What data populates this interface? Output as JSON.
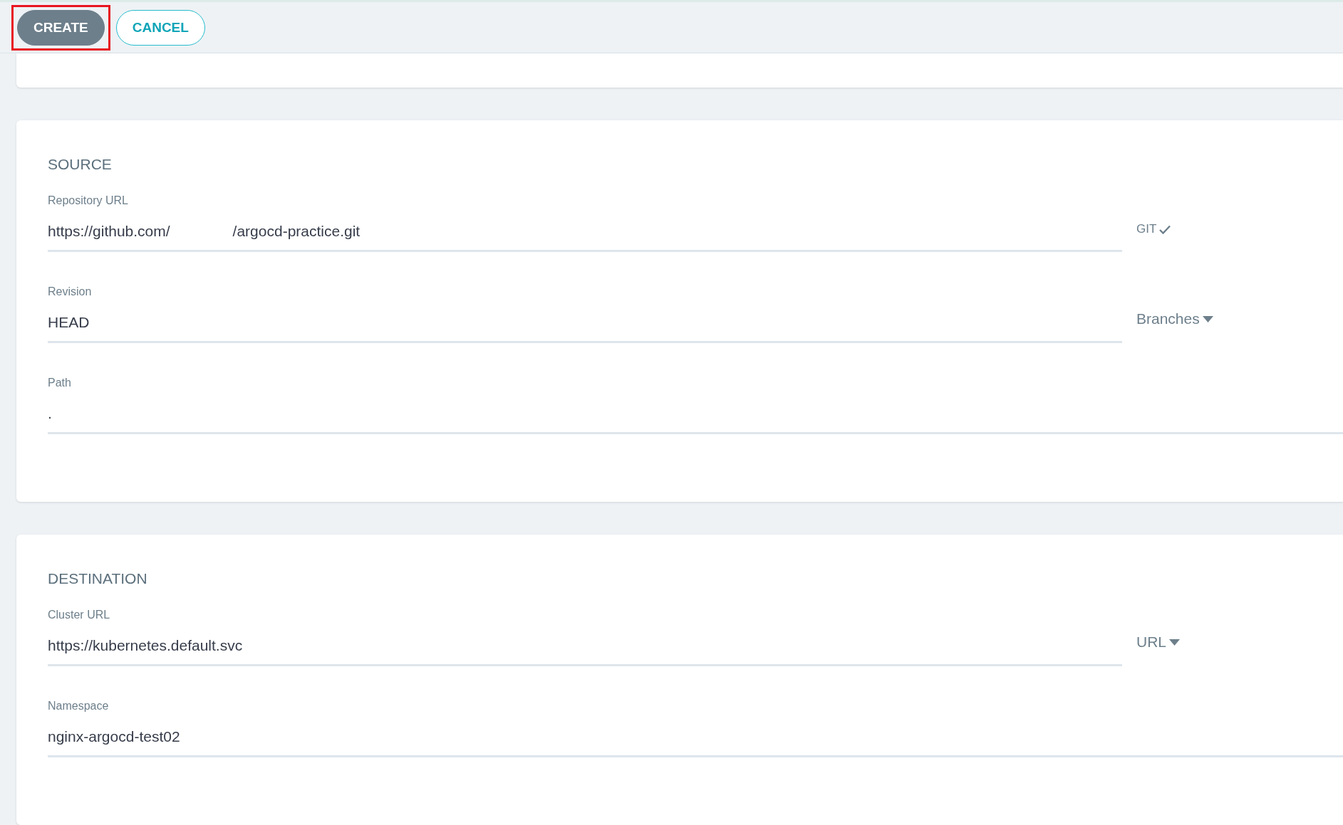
{
  "toolbar": {
    "buttons": [
      {
        "label": "CREATE",
        "kind": "primary",
        "highlighted": true
      },
      {
        "label": "CANCEL",
        "kind": "outline",
        "highlighted": false
      }
    ]
  },
  "sections": [
    {
      "title": "SOURCE",
      "fields": [
        {
          "label": "Repository URL",
          "value_parts": [
            "https://github.com/",
            "/argocd-practice.git"
          ],
          "addon": {
            "text": "GIT",
            "kind": "check"
          }
        },
        {
          "label": "Revision",
          "value_parts": [
            "HEAD"
          ],
          "addon": {
            "text": "Branches",
            "kind": "dropdown"
          }
        },
        {
          "label": "Path",
          "value_parts": [
            "."
          ]
        }
      ]
    },
    {
      "title": "DESTINATION",
      "fields": [
        {
          "label": "Cluster URL",
          "value_parts": [
            "https://kubernetes.default.svc"
          ],
          "addon": {
            "text": "URL",
            "kind": "dropdown"
          }
        },
        {
          "label": "Namespace",
          "value_parts": [
            "nginx-argocd-test02"
          ]
        }
      ]
    }
  ]
}
